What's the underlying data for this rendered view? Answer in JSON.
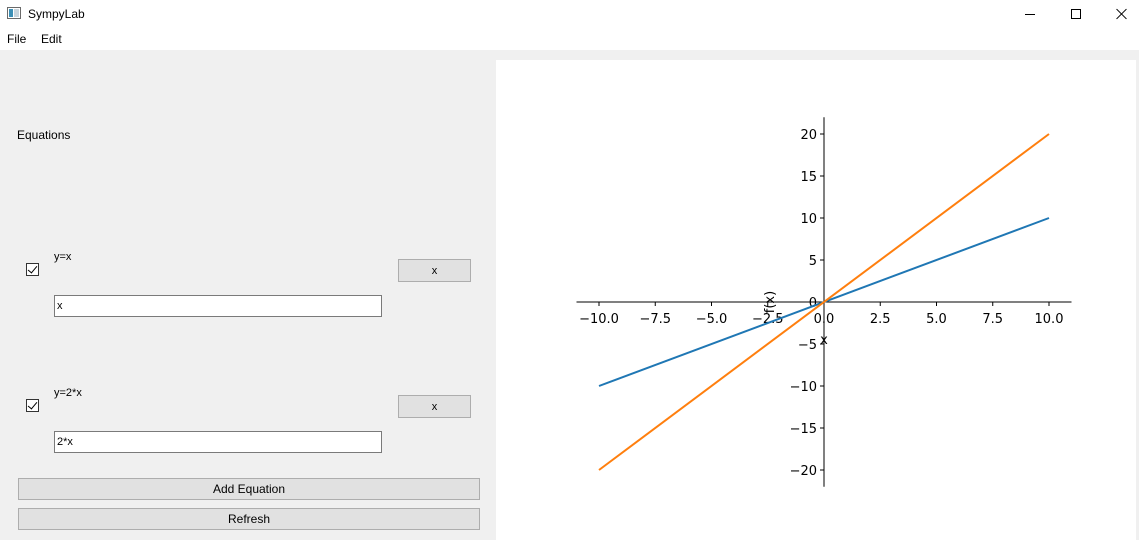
{
  "window": {
    "title": "SympyLab",
    "minimize_icon": "minimize-icon",
    "maximize_icon": "maximize-icon",
    "close_icon": "close-icon"
  },
  "menu": {
    "items": [
      {
        "label": "File"
      },
      {
        "label": "Edit"
      }
    ]
  },
  "left_panel": {
    "section_label": "Equations",
    "equations": [
      {
        "checked": true,
        "label": "y=x",
        "value": "x",
        "remove_label": "x"
      },
      {
        "checked": true,
        "label": "y=2*x",
        "value": "2*x",
        "remove_label": "x"
      }
    ],
    "add_button": "Add Equation",
    "refresh_button": "Refresh"
  },
  "chart_data": {
    "type": "line",
    "xlabel": "x",
    "ylabel": "f(x)",
    "xlim": [
      -11,
      11
    ],
    "ylim": [
      -22,
      22
    ],
    "xticks": [
      -10.0,
      -7.5,
      -5.0,
      -2.5,
      0.0,
      2.5,
      5.0,
      7.5,
      10.0
    ],
    "xtick_labels": [
      "−10.0",
      "−7.5",
      "−5.0",
      "−2.5",
      "0.0",
      "2.5",
      "5.0",
      "7.5",
      "10.0"
    ],
    "yticks": [
      -20,
      -15,
      -10,
      -5,
      0,
      5,
      10,
      15,
      20
    ],
    "ytick_labels": [
      "−20",
      "−15",
      "−10",
      "−5",
      "0",
      "5",
      "10",
      "15",
      "20"
    ],
    "series": [
      {
        "color": "#1f77b4",
        "x": [
          -10,
          10
        ],
        "y": [
          -10,
          10
        ]
      },
      {
        "color": "#ff7f0e",
        "x": [
          -10,
          10
        ],
        "y": [
          -20,
          20
        ]
      }
    ],
    "grid": false,
    "legend": false
  }
}
